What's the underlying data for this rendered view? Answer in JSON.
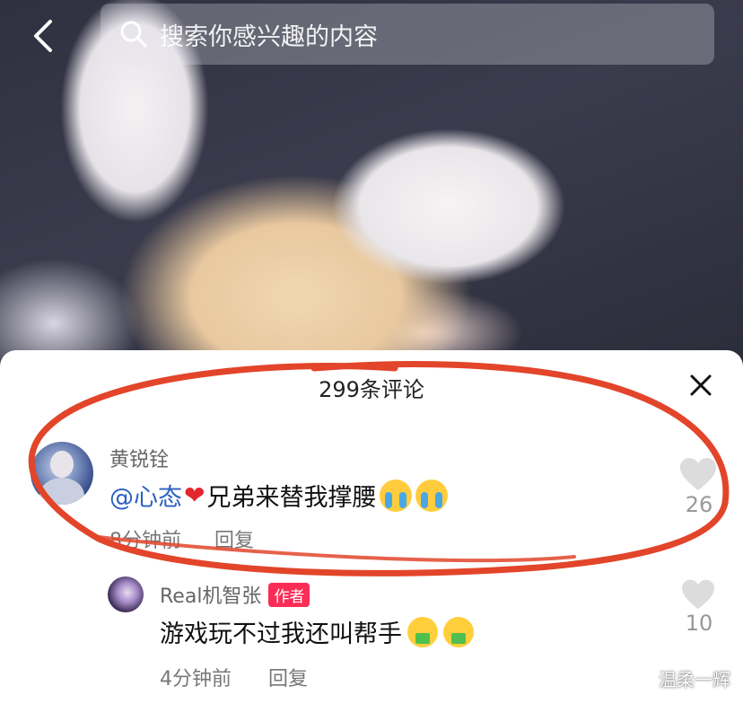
{
  "header": {
    "search_placeholder": "搜索你感兴趣的内容",
    "icons": {
      "back": "chevron-left-icon",
      "search": "search-icon"
    }
  },
  "sheet": {
    "title": "299条评论",
    "close_icon": "close-icon"
  },
  "comments": [
    {
      "author": "黄锐铨",
      "mention": "@心态",
      "emoji_heart": "❤",
      "text": "兄弟来替我撑腰",
      "emojis": [
        "loudly-crying-face",
        "loudly-crying-face"
      ],
      "time": "8分钟前",
      "reply_label": "回复",
      "likes": "26"
    }
  ],
  "replies": [
    {
      "author": "Real机智张",
      "badge": "作者",
      "text": "游戏玩不过我还叫帮手",
      "emojis": [
        "money-mouth-face",
        "money-mouth-face"
      ],
      "time": "4分钟前",
      "reply_label": "回复",
      "likes": "10"
    }
  ],
  "watermark": "温柔一辉",
  "colors": {
    "accent_red": "#fb2c55",
    "mention_blue": "#2b61c2",
    "annotation_red": "#e2452a"
  }
}
